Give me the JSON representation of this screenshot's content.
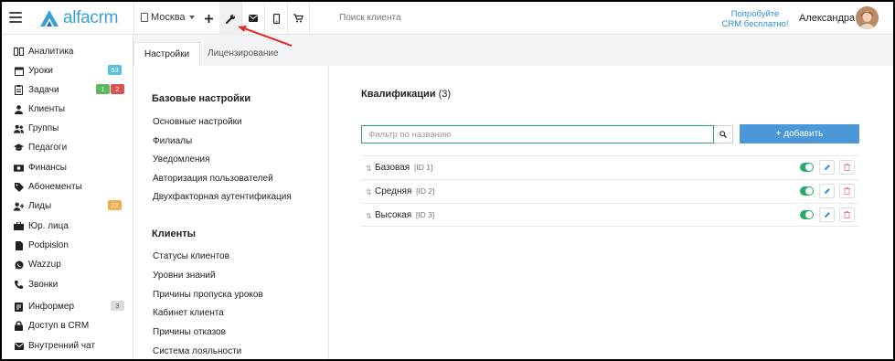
{
  "header": {
    "logo_text": "alfacrm",
    "city": "Москва",
    "search_placeholder": "Поиск клиента",
    "promo_line1": "Попробуйте",
    "promo_line2": "CRM бесплатно!",
    "user_name": "Александра",
    "icons": [
      "menu-icon",
      "plus-icon",
      "wrench-icon",
      "envelope-icon",
      "phone-icon",
      "cart-icon"
    ]
  },
  "sidebar": {
    "items": [
      {
        "label": "Аналитика",
        "icon": "analytics-icon"
      },
      {
        "label": "Уроки",
        "icon": "calendar-icon",
        "badge": "53"
      },
      {
        "label": "Задачи",
        "icon": "tasks-icon",
        "badge": "1",
        "badge2": "2"
      },
      {
        "label": "Клиенты",
        "icon": "user-icon"
      },
      {
        "label": "Группы",
        "icon": "users-icon"
      },
      {
        "label": "Педагоги",
        "icon": "graduation-cap-icon"
      },
      {
        "label": "Финансы",
        "icon": "money-icon"
      },
      {
        "label": "Абонементы",
        "icon": "tag-icon"
      },
      {
        "label": "Лиды",
        "icon": "user-plus-icon",
        "badge": "22"
      },
      {
        "label": "Юр. лица",
        "icon": "briefcase-icon"
      },
      {
        "label": "Podpislon",
        "icon": "file-icon"
      },
      {
        "label": "Wazzup",
        "icon": "whatsapp-icon"
      },
      {
        "label": "Звонки",
        "icon": "phone-icon"
      },
      {
        "label": "Информер",
        "icon": "informer-icon",
        "badge": "3"
      },
      {
        "label": "Доступ в CRM",
        "icon": "lock-icon"
      },
      {
        "label": "Внутренний чат",
        "icon": "chat-icon"
      }
    ],
    "colors": {
      "badge_blue": "#5bc0de",
      "badge_green": "#5cb85c",
      "badge_red": "#d9534f",
      "badge_orange": "#f0ad4e",
      "badge_gray": "#d5dbe0"
    }
  },
  "tabs": [
    {
      "label": "Настройки"
    },
    {
      "label": "Лицензирование"
    }
  ],
  "menu": {
    "section1": {
      "title": "Базовые настройки",
      "links": [
        "Основные настройки",
        "Филиалы",
        "Уведомления",
        "Авторизация пользователей",
        "Двухфакторная аутентификация"
      ]
    },
    "section2": {
      "title": "Клиенты",
      "links": [
        "Статусы клиентов",
        "Уровни знаний",
        "Причины пропуска уроков",
        "Кабинет клиента",
        "Причины отказов",
        "Система лояльности"
      ]
    }
  },
  "content": {
    "title": "Квалификации",
    "count": "(3)",
    "filter_placeholder": "Фильтр по названию",
    "add_button": "+ добавить",
    "rows": [
      {
        "name": "Базовая",
        "id": "[ID 1]"
      },
      {
        "name": "Средняя",
        "id": "[ID 2]"
      },
      {
        "name": "Высокая",
        "id": "[ID 3]"
      }
    ],
    "accent_color": "#2aa86a",
    "button_color": "#4a98d8"
  }
}
